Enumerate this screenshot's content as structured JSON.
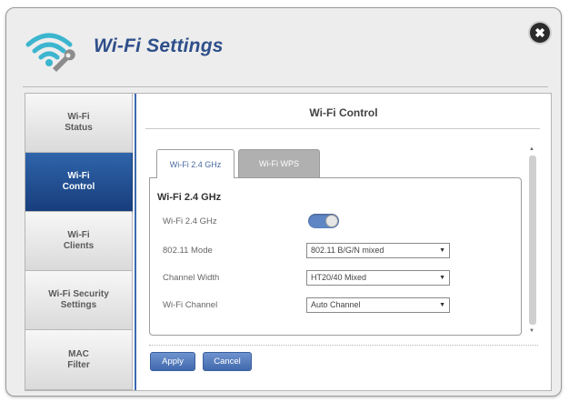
{
  "header": {
    "title": "Wi-Fi Settings",
    "logo_icon": "wifi-wrench-icon",
    "close_icon": "close-icon",
    "close_glyph": "✖"
  },
  "sidebar": {
    "items": [
      {
        "label": "Wi-Fi\nStatus",
        "active": false
      },
      {
        "label": "Wi-Fi\nControl",
        "active": true
      },
      {
        "label": "Wi-Fi\nClients",
        "active": false
      },
      {
        "label": "Wi-Fi Security\nSettings",
        "active": false
      },
      {
        "label": "MAC\nFilter",
        "active": false
      }
    ]
  },
  "main": {
    "title": "Wi-Fi Control",
    "tabs": [
      {
        "label": "Wi-Fi 2.4 GHz",
        "active": true
      },
      {
        "label": "Wi-Fi WPS",
        "active": false
      }
    ],
    "section_heading": "Wi-Fi 2.4 GHz",
    "fields": {
      "wifi_toggle": {
        "label": "Wi-Fi 2.4 GHz",
        "on": true
      },
      "mode": {
        "label": "802.11 Mode",
        "value": "802.11 B/G/N mixed"
      },
      "channel_width": {
        "label": "Channel Width",
        "value": "HT20/40 Mixed"
      },
      "channel": {
        "label": "Wi-Fi Channel",
        "value": "Auto Channel"
      }
    },
    "buttons": {
      "apply": "Apply",
      "cancel": "Cancel"
    }
  },
  "colors": {
    "accent": "#2e4f8a",
    "active_nav": "#1f4e96",
    "button": "#4f77bb",
    "toggle_on": "#5f86c4"
  }
}
